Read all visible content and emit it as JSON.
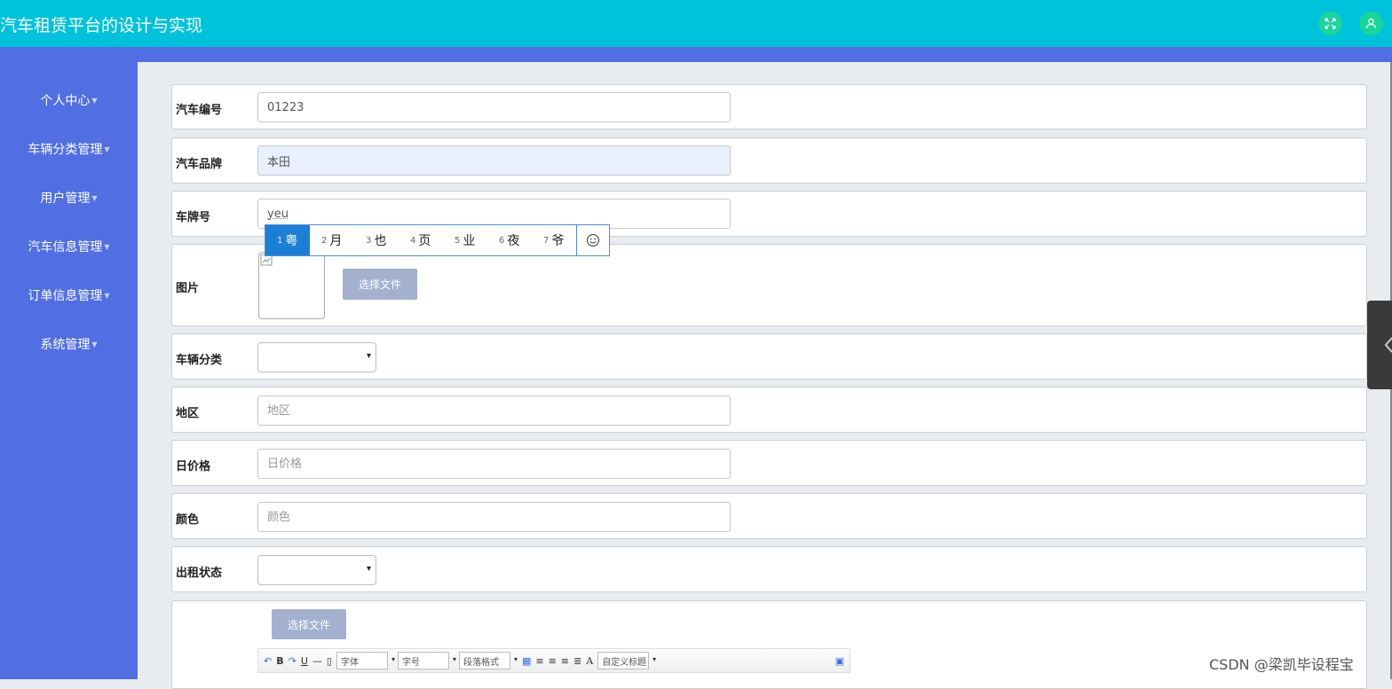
{
  "header": {
    "title": "汽车租赁平台的设计与实现"
  },
  "sidebar": {
    "items": [
      {
        "label": "个人中心"
      },
      {
        "label": "车辆分类管理"
      },
      {
        "label": "用户管理"
      },
      {
        "label": "汽车信息管理"
      },
      {
        "label": "订单信息管理"
      },
      {
        "label": "系统管理"
      }
    ]
  },
  "form": {
    "car_no": {
      "label": "汽车编号",
      "value": "01223"
    },
    "brand": {
      "label": "汽车品牌",
      "value": "本田"
    },
    "plate": {
      "label": "车牌号",
      "value": "yeu"
    },
    "image": {
      "label": "图片",
      "button": "选择文件"
    },
    "category": {
      "label": "车辆分类",
      "value": ""
    },
    "region": {
      "label": "地区",
      "placeholder": "地区"
    },
    "price": {
      "label": "日价格",
      "placeholder": "日价格"
    },
    "color": {
      "label": "颜色",
      "placeholder": "颜色"
    },
    "status": {
      "label": "出租状态",
      "value": ""
    },
    "detail": {
      "button": "选择文件"
    }
  },
  "ime": {
    "candidates": [
      {
        "num": "1",
        "text": "粤"
      },
      {
        "num": "2",
        "text": "月"
      },
      {
        "num": "3",
        "text": "也"
      },
      {
        "num": "4",
        "text": "页"
      },
      {
        "num": "5",
        "text": "业"
      },
      {
        "num": "6",
        "text": "夜"
      },
      {
        "num": "7",
        "text": "爷"
      }
    ]
  },
  "editor": {
    "font_label": "字体",
    "size_label": "字号",
    "paragraph_label": "段落格式",
    "custom_title_label": "自定义标题",
    "bold": "B",
    "underline": "U",
    "font_color": "A"
  },
  "watermark": "CSDN @梁凯毕设程宝",
  "colors": {
    "topbar": "#00c2da",
    "sidebar": "#516fe3",
    "icon_btn": "#18d69a",
    "ime_active": "#1c7fd6"
  }
}
